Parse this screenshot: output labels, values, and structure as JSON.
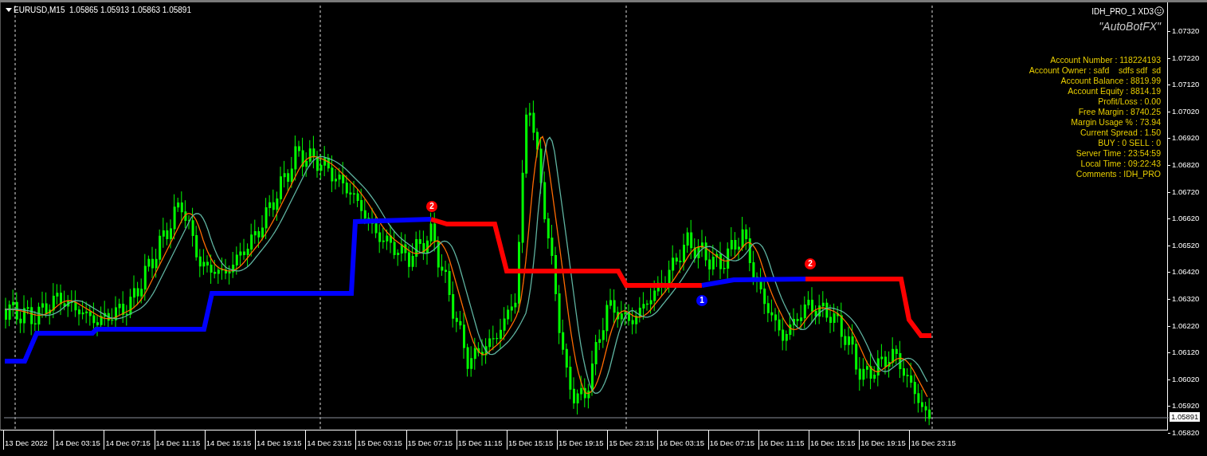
{
  "chart": {
    "symbol_info": "EURUSD,M15  1.05865 1.05913 1.05863 1.05891",
    "expert_name": "IDH_PRO_1 XD3",
    "tagline": "\"AutoBotFX\"",
    "info_lines": [
      "Account Number : 118224193",
      "Account Owner : safd    sdfs sdf  sd",
      "Account Balance : 8819.99",
      "Account Equity : 8814.19",
      "Profit/Loss : 0.00",
      "Free Margin : 8740.25",
      "Margin Usage % : 73.94",
      "Current Spread : 1.50",
      "BUY : 0 SELL : 0",
      "Server Time : 23:54:59",
      "Local Time : 09:22:43",
      "Comments : IDH_PRO"
    ],
    "markers": [
      {
        "label": "2",
        "color": "#ff0000"
      },
      {
        "label": "1",
        "color": "#0000ff"
      },
      {
        "label": "2",
        "color": "#ff0000"
      }
    ],
    "price_axis": [
      "1.07320",
      "1.07220",
      "1.07120",
      "1.07020",
      "1.06920",
      "1.06820",
      "1.06720",
      "1.06620",
      "1.06520",
      "1.06420",
      "1.06320",
      "1.06220",
      "1.06120",
      "1.06020",
      "1.05920",
      "1.05820"
    ],
    "current_price": "1.05891",
    "time_axis": [
      "13 Dec 2022",
      "14 Dec 03:15",
      "14 Dec 07:15",
      "14 Dec 11:15",
      "14 Dec 15:15",
      "14 Dec 19:15",
      "14 Dec 23:15",
      "15 Dec 03:15",
      "15 Dec 07:15",
      "15 Dec 11:15",
      "15 Dec 15:15",
      "15 Dec 19:15",
      "15 Dec 23:15",
      "16 Dec 03:15",
      "16 Dec 07:15",
      "16 Dec 11:15",
      "16 Dec 15:15",
      "16 Dec 19:15",
      "16 Dec 23:15"
    ]
  }
}
